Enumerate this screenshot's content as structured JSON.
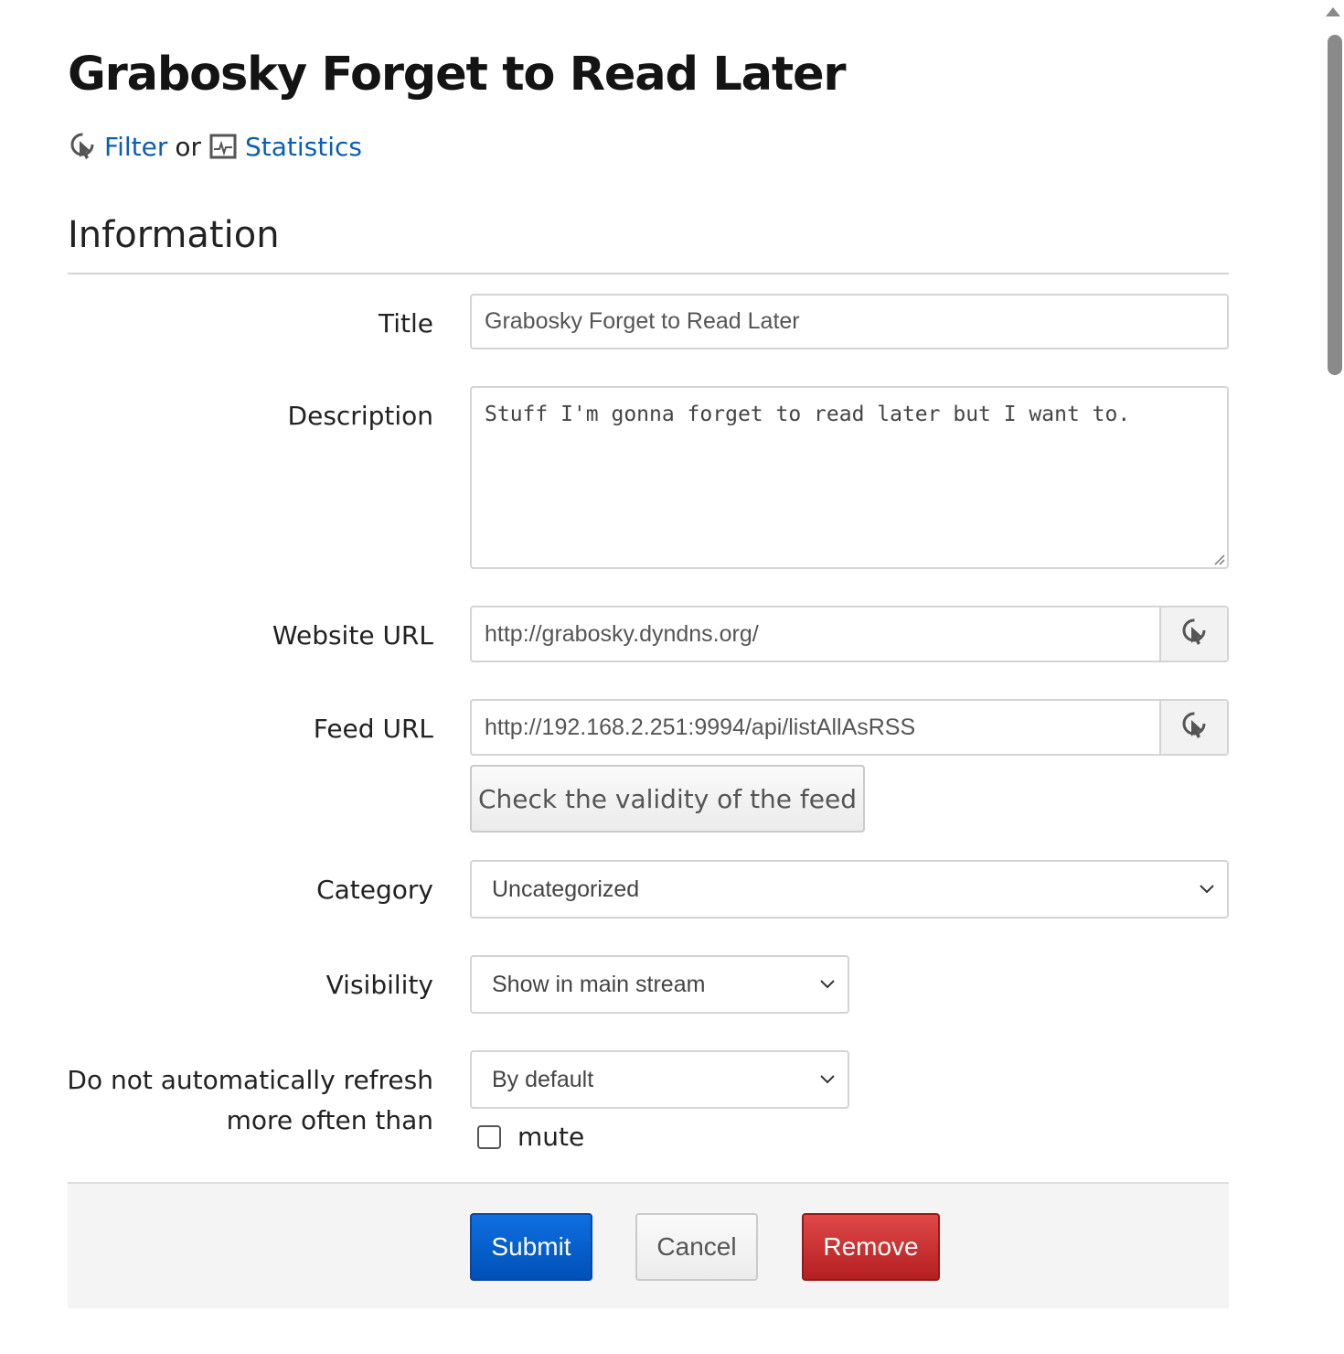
{
  "page": {
    "title": "Grabosky Forget to Read Later",
    "filter_link": "Filter",
    "or_text": "or",
    "statistics_link": "Statistics",
    "section_title": "Information"
  },
  "form": {
    "title": {
      "label": "Title",
      "value": "Grabosky Forget to Read Later"
    },
    "description": {
      "label": "Description",
      "value": "Stuff I'm gonna forget to read later but I want to."
    },
    "website_url": {
      "label": "Website URL",
      "value": "http://grabosky.dyndns.org/"
    },
    "feed_url": {
      "label": "Feed URL",
      "value": "http://192.168.2.251:9994/api/listAllAsRSS"
    },
    "check_button": "Check the validity of the feed",
    "category": {
      "label": "Category",
      "selected": "Uncategorized"
    },
    "visibility": {
      "label": "Visibility",
      "selected": "Show in main stream"
    },
    "refresh": {
      "label_line1": "Do not automatically refresh",
      "label_line2": "more often than",
      "selected": "By default"
    },
    "mute": {
      "label": "mute",
      "checked": false
    }
  },
  "actions": {
    "submit": "Submit",
    "cancel": "Cancel",
    "remove": "Remove"
  },
  "icons": {
    "filter": "link-cursor-icon",
    "statistics": "chart-icon",
    "website_open": "link-cursor-icon",
    "feed_open": "link-cursor-icon",
    "dropdown": "chevron-down-icon"
  },
  "colors": {
    "link": "#0a5eb5",
    "submit": "#0062d1",
    "remove": "#c52a2a"
  }
}
